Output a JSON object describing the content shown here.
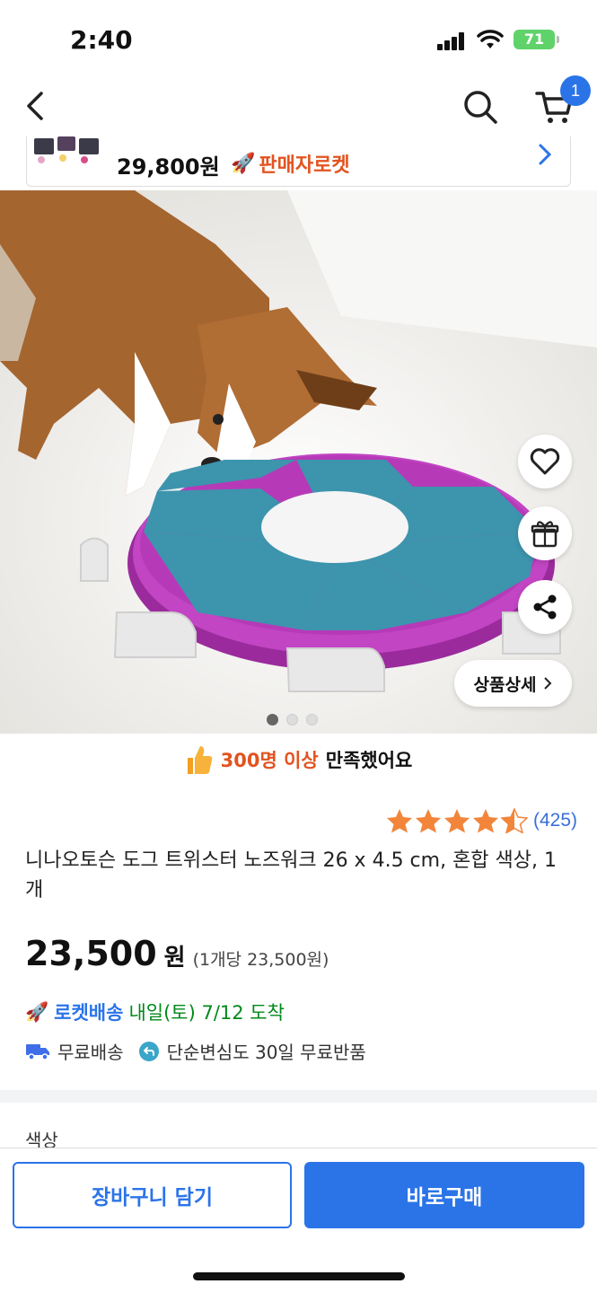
{
  "status_bar": {
    "time": "2:40",
    "battery": "71"
  },
  "nav": {
    "cart_count": "1"
  },
  "mini_card": {
    "price": "29,800원",
    "badge": "판매자로켓"
  },
  "hero": {
    "detail_label": "상품상세",
    "dots_total": 3,
    "active_dot": 1
  },
  "satisfaction": {
    "highlight": "300명 이상",
    "text": "만족했어요"
  },
  "rating": {
    "stars": 4.5,
    "count": "(425)"
  },
  "product": {
    "title": "니나오토슨 도그 트위스터 노즈워크 26 x 4.5 cm, 혼합 색상, 1개",
    "price": "23,500",
    "currency": "원",
    "unit_price": "(1개당 23,500원)"
  },
  "delivery": {
    "rocket_label": "로켓배송",
    "eta": "내일(토) 7/12 도착",
    "free_shipping": "무료배송",
    "free_return": "단순변심도 30일 무료반품"
  },
  "options": {
    "color_label": "색상"
  },
  "actions": {
    "add_to_cart": "장바구니 담기",
    "buy_now": "바로구매"
  },
  "colors": {
    "accent": "#2b74e8",
    "highlight": "#e2531f",
    "eta": "#00891a"
  }
}
